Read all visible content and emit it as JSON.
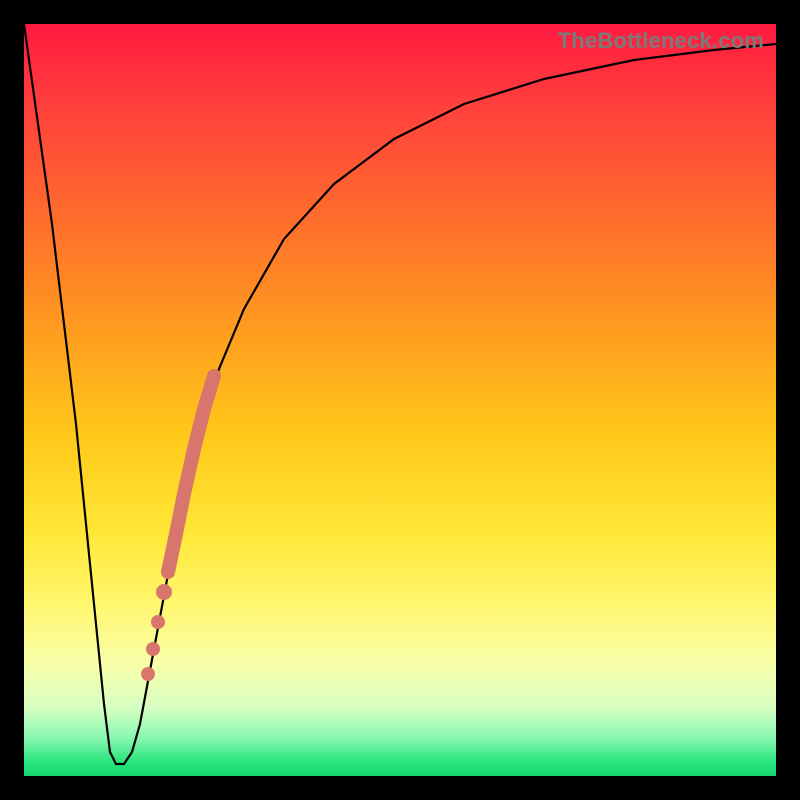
{
  "watermark": "TheBottleneck.com",
  "colors": {
    "frame": "#000000",
    "curve": "#000000",
    "highlight": "#d8766e"
  },
  "chart_data": {
    "type": "line",
    "title": "",
    "xlabel": "",
    "ylabel": "",
    "x_range": [
      0,
      100
    ],
    "y_range": [
      0,
      100
    ],
    "axes_visible": false,
    "grid": false,
    "background_gradient": {
      "orientation": "vertical",
      "stops": [
        {
          "pos": 0.0,
          "color": "#ff1a3f"
        },
        {
          "pos": 0.4,
          "color": "#ff9a1f"
        },
        {
          "pos": 0.68,
          "color": "#ffe838"
        },
        {
          "pos": 0.91,
          "color": "#d6ffc2"
        },
        {
          "pos": 1.0,
          "color": "#14d66d"
        }
      ]
    },
    "series": [
      {
        "name": "bottleneck-curve",
        "x": [
          0,
          3,
          6,
          8,
          10,
          11,
          12,
          13,
          14,
          16,
          18,
          20,
          22,
          24,
          27,
          30,
          35,
          40,
          47,
          55,
          65,
          78,
          90,
          100
        ],
        "y": [
          100,
          70,
          40,
          20,
          6,
          2,
          2,
          2,
          6,
          18,
          30,
          41,
          50,
          57,
          65,
          71,
          78,
          83,
          88,
          91,
          94,
          96,
          97,
          97.5
        ]
      }
    ],
    "highlight_segment": {
      "description": "pink thick band on the rising branch",
      "x_start": 18,
      "x_end": 24,
      "y_start": 30,
      "y_end": 57
    },
    "highlight_dots": [
      {
        "x": 16.5,
        "y": 22,
        "r_rel": 0.9
      },
      {
        "x": 17.3,
        "y": 26,
        "r_rel": 0.9
      },
      {
        "x": 18.2,
        "y": 31,
        "r_rel": 1.1
      },
      {
        "x": 24.5,
        "y": 58,
        "r_rel": 1.0
      }
    ]
  }
}
